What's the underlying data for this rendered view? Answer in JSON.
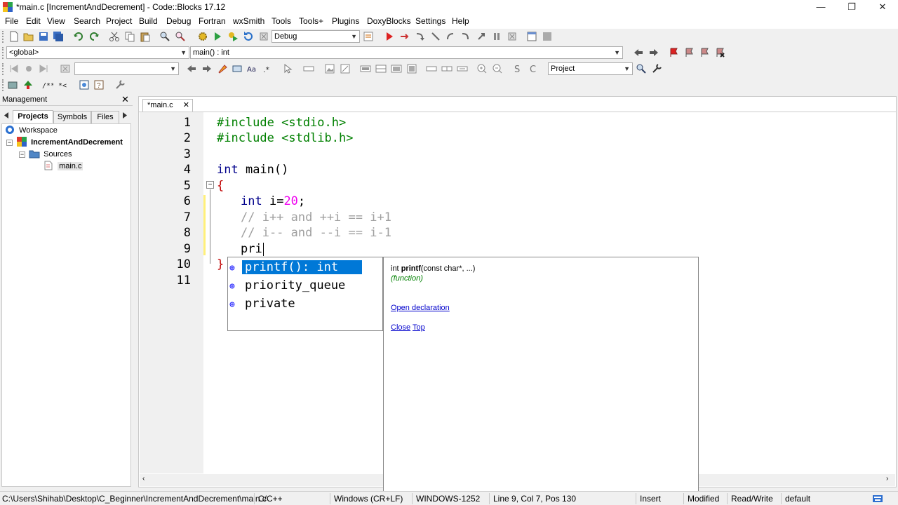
{
  "window": {
    "title": "*main.c [IncrementAndDecrement] - Code::Blocks 17.12"
  },
  "menu": [
    "File",
    "Edit",
    "View",
    "Search",
    "Project",
    "Build",
    "Debug",
    "Fortran",
    "wxSmith",
    "Tools",
    "Tools+",
    "Plugins",
    "DoxyBlocks",
    "Settings",
    "Help"
  ],
  "toolbar": {
    "build_target": "Debug",
    "scope": "<global>",
    "function": "main() : int",
    "search_scope": "Project"
  },
  "management": {
    "title": "Management",
    "tabs": [
      "Projects",
      "Symbols",
      "Files"
    ],
    "tree": {
      "workspace": "Workspace",
      "project": "IncrementAndDecrement",
      "folder": "Sources",
      "file": "main.c"
    }
  },
  "editor": {
    "tab_label": "*main.c",
    "line_numbers": [
      "1",
      "2",
      "3",
      "4",
      "5",
      "6",
      "7",
      "8",
      "9",
      "10",
      "11"
    ],
    "code": {
      "l1": "#include <stdio.h>",
      "l2": "#include <stdlib.h>",
      "l4_kw": "int",
      "l4_rest": " main()",
      "l5": "{",
      "l6_kw": "int",
      "l6_var": " i=",
      "l6_num": "20",
      "l6_end": ";",
      "l7": "// i++ and ++i == i+1",
      "l8": "// i-- and --i == i-1",
      "l9": "pri",
      "l10": "}"
    }
  },
  "autocomplete": {
    "items": [
      "printf(): int",
      "priority_queue",
      "private"
    ],
    "doc": {
      "signature_prefix": "int ",
      "signature_name": "printf",
      "signature_args": "(const char*, ...)",
      "kind": "(function)",
      "open_decl": "Open declaration",
      "close": "Close",
      "top": "Top"
    }
  },
  "status": {
    "path": "C:\\Users\\Shihab\\Desktop\\C_Beginner\\IncrementAndDecrement\\main.c",
    "language": "C/C++",
    "eol": "Windows (CR+LF)",
    "encoding": "WINDOWS-1252",
    "position": "Line 9, Col 7, Pos 130",
    "mode": "Insert",
    "modified": "Modified",
    "access": "Read/Write",
    "profile": "default"
  }
}
